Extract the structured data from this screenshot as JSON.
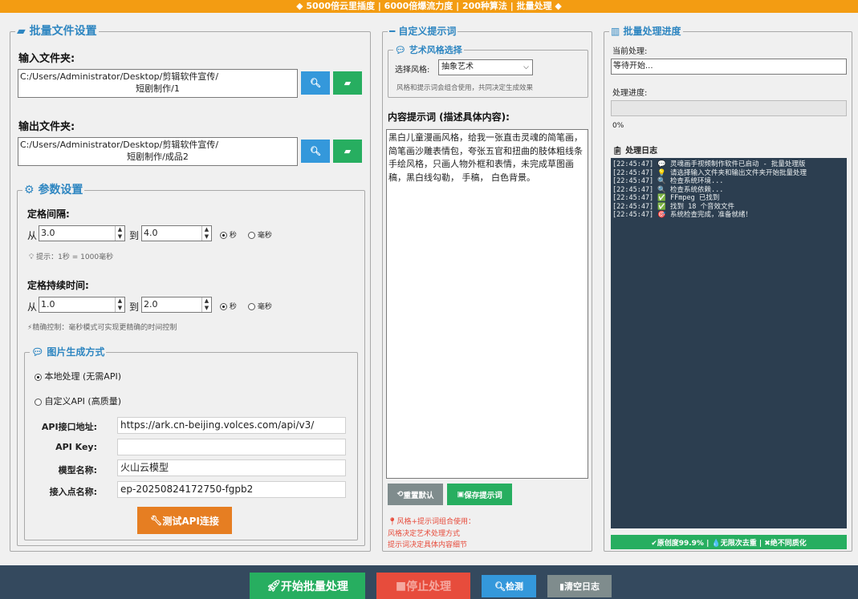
{
  "header": {
    "banner": "◆ 5000倍云里插度 | 6000倍爆流力度 | 200种算法 | 批量处理 ◆"
  },
  "batch": {
    "title": "批量文件设置",
    "input_label": "输入文件夹:",
    "input_path_line1": "C:/Users/Administrator/Desktop/剪辑软件宣传/",
    "input_path_line2": "短剧制作/1",
    "output_label": "输出文件夹:",
    "output_path_line1": "C:/Users/Administrator/Desktop/剪辑软件宣传/",
    "output_path_line2": "短剧制作/成品2"
  },
  "params": {
    "title": "参数设置",
    "interval_label": "定格间隔:",
    "from": "从",
    "to": "到",
    "interval_from": "3.0",
    "interval_to": "4.0",
    "unit_sec": "秒",
    "unit_ms": "毫秒",
    "hint1": "提示：1秒 = 1000毫秒",
    "duration_label": "定格持续时间:",
    "duration_from": "1.0",
    "duration_to": "2.0",
    "hint2": "⚡精确控制：毫秒模式可实现更精确的时间控制"
  },
  "imagegen": {
    "title": "图片生成方式",
    "local": "本地处理 (无需API)",
    "custom": "自定义API (高质量)",
    "api_url_label": "API接口地址:",
    "api_url": "https://ark.cn-beijing.volces.com/api/v3/",
    "api_key_label": "API Key:",
    "api_key": "",
    "model_label": "模型名称:",
    "model": "火山云模型",
    "endpoint_label": "接入点名称:",
    "endpoint": "ep-20250824172750-fgpb2",
    "test_btn": "测试API连接"
  },
  "prompt": {
    "title": "自定义提示词",
    "style_group": "艺术风格选择",
    "style_label": "选择风格:",
    "style_value": "抽象艺术",
    "style_hint": "风格和提示词会组合使用，共同决定生成效果",
    "content_label": "内容提示词 (描述具体内容):",
    "content_text": "黑白儿童漫画风格，给我一张直击灵魂的简笔画，简笔画沙雕表情包，夸张五官和扭曲的肢体粗线条手绘风格，只画人物外框和表情，未完成草图画稿，黑白线勾勒， 手稿， 白色背景。",
    "reset_btn": "重置默认",
    "save_btn": "保存提示词",
    "tip1": "风格+提示词组合使用：",
    "tip2": "风格决定艺术处理方式",
    "tip3": "提示词决定具体内容细节"
  },
  "progress": {
    "title": "批量处理进度",
    "current_label": "当前处理:",
    "current_value": "等待开始...",
    "progress_label": "处理进度:",
    "progress_pct": "0%",
    "progress_value": 0,
    "log_label": "处理日志",
    "log_lines": [
      "[22:45:47] 💬 灵魂画手视频制作软件已启动 - 批量处理版",
      "[22:45:47] 💡 请选择输入文件夹和输出文件夹开始批量处理",
      "[22:45:47] 🔍 检查系统环境...",
      "[22:45:47] 🔍 检查系统依赖...",
      "[22:45:47] ✅ FFmpeg 已找到",
      "[22:45:47] ✅ 找到 18 个音效文件",
      "[22:45:47] 🎯 系统检查完成，准备就绪！"
    ],
    "badge": "✔原创度99.9% | 💧无限次去重 | ✖绝不同质化"
  },
  "footer": {
    "start": "开始批量处理",
    "stop": "停止处理",
    "detect": "检测",
    "clear": "清空日志"
  },
  "colors": {
    "accent": "#2e86c1",
    "orange": "#f39c12",
    "green": "#27ae60",
    "blue": "#3498db",
    "red": "#e74c3c",
    "dark": "#34495e"
  }
}
